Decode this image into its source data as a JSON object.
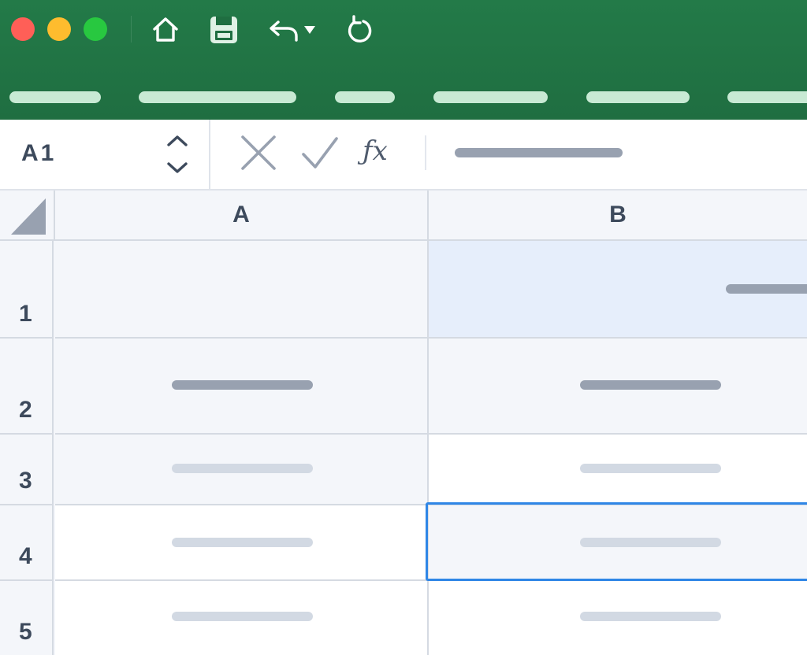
{
  "toolbar": {
    "window_controls": [
      {
        "name": "close",
        "color": "#ff5f57"
      },
      {
        "name": "minimize",
        "color": "#febc2e"
      },
      {
        "name": "zoom",
        "color": "#28c840"
      }
    ],
    "tools": [
      "home-icon",
      "save-icon",
      "undo-icon",
      "undo-dropdown-icon",
      "redo-icon"
    ],
    "ribbon_tab_count": 6
  },
  "formula_bar": {
    "name_box": "A1",
    "fx_label": "ƒx"
  },
  "grid": {
    "columns": [
      "A",
      "B"
    ],
    "rows": [
      "1",
      "2",
      "3",
      "4",
      "5"
    ],
    "selected_cell": "B4",
    "highlighted_cell": "B1"
  },
  "colors": {
    "ribbon": "#237a48",
    "ribbon_tab": "#c8ead4",
    "selection": "#2f86e6",
    "highlight": "#e6eefb",
    "grid_line": "#d5dae2",
    "header_text": "#3d4a5c"
  }
}
